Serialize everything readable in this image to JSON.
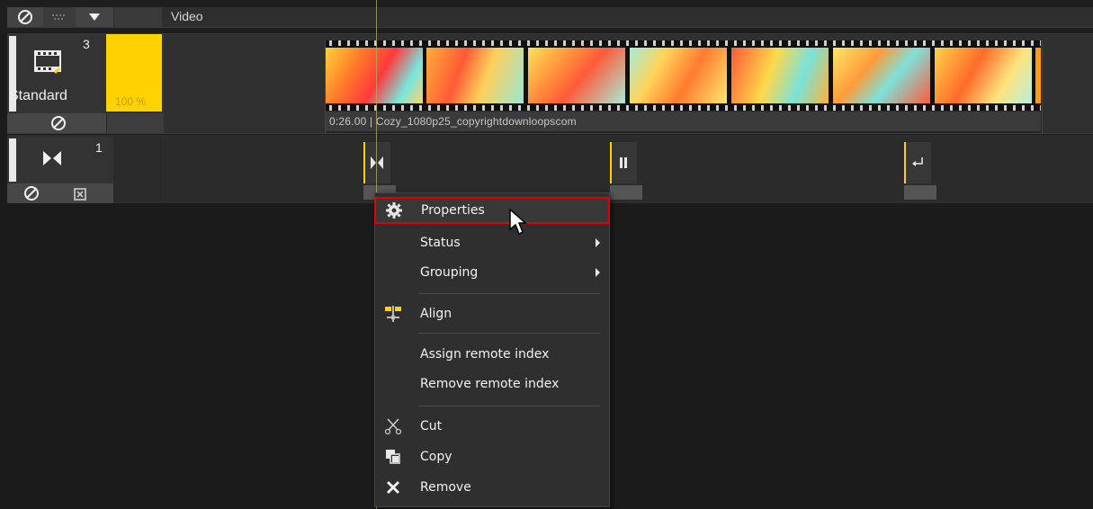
{
  "header": {
    "track_type_label": "Video",
    "icons": [
      "no-sign-icon",
      "grid-icon",
      "dropdown-triangle-icon"
    ]
  },
  "track1": {
    "number": "3",
    "mode_label": "Standard",
    "volume_label": "100 %",
    "clip": {
      "caption": "0:26.00 | Cozy_1080p25_copyrightdownloopscom"
    }
  },
  "track2": {
    "number": "1",
    "markers": [
      "transition-marker",
      "pause-marker",
      "loop-marker"
    ]
  },
  "context_menu": {
    "items": [
      {
        "label": "Properties",
        "icon": "gear-icon",
        "submenu": false,
        "highlighted": true
      },
      {
        "label": "Status",
        "icon": "",
        "submenu": true
      },
      {
        "label": "Grouping",
        "icon": "",
        "submenu": true
      },
      {
        "label": "Align",
        "icon": "align-icon",
        "submenu": false
      },
      {
        "label": "Assign remote index",
        "icon": "",
        "submenu": false
      },
      {
        "label": "Remove remote index",
        "icon": "",
        "submenu": false
      },
      {
        "label": "Cut",
        "icon": "scissors-icon",
        "submenu": false
      },
      {
        "label": "Copy",
        "icon": "copy-icon",
        "submenu": false
      },
      {
        "label": "Remove",
        "icon": "x-icon",
        "submenu": false
      }
    ]
  },
  "colors": {
    "accent": "#ffd200",
    "highlight_border": "#e00000",
    "menu_bg": "#2f2f2f"
  }
}
